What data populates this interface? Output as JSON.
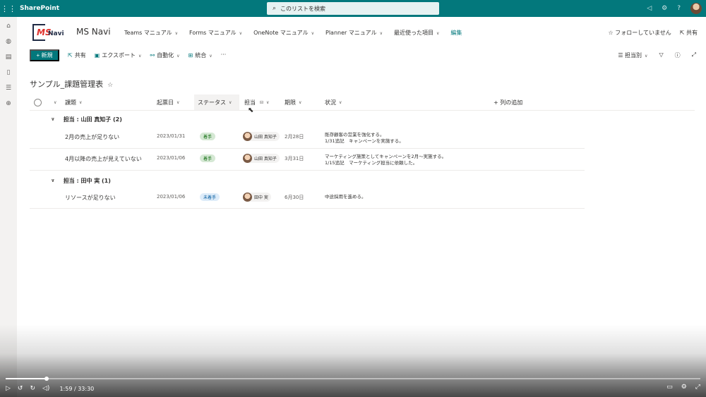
{
  "suitebar": {
    "brand": "SharePoint",
    "search_placeholder": "このリストを検索"
  },
  "site": {
    "logo_ms": "MS",
    "logo_navi": "Navi",
    "title": "MS Navi",
    "nav": [
      {
        "label": "Teams マニュアル"
      },
      {
        "label": "Forms マニュアル"
      },
      {
        "label": "OneNote マニュアル"
      },
      {
        "label": "Planner マニュアル"
      },
      {
        "label": "最近使った項目"
      },
      {
        "label": "編集"
      }
    ],
    "follow": "☆ フォローしていません",
    "share": "共有"
  },
  "commands": {
    "new": "+ 新規",
    "share": "共有",
    "export": "エクスポート",
    "automate": "自動化",
    "integrate": "統合",
    "more": "···",
    "view": "担当別"
  },
  "list": {
    "title": "サンプル_課題管理表",
    "columns": {
      "issue": "課題",
      "date": "起票日",
      "status": "ステータス",
      "assignee": "担当",
      "deadline": "期限",
      "situation": "状況",
      "add": "+ 列の追加"
    },
    "groups": [
      {
        "header": "担当 : 山田 真知子 (2)",
        "rows": [
          {
            "issue": "2月の売上が足りない",
            "date": "2023/01/31",
            "status": "着手",
            "assignee": "山田 真知子",
            "deadline": "2月28日",
            "situation_1": "既存顧客の営業を強化する。",
            "situation_2": "1/31追記　キャンペーンを実施する。"
          },
          {
            "issue": "4月以降の売上が見えていない",
            "date": "2023/01/06",
            "status": "着手",
            "assignee": "山田 真知子",
            "deadline": "3月31日",
            "situation_1": "マーケティング施策としてキャンペーンを2月～実施する。",
            "situation_2": "1/15追記　マーケティング担当に依頼した。"
          }
        ]
      },
      {
        "header": "担当 : 田中 実 (1)",
        "rows": [
          {
            "issue": "リソースが足りない",
            "date": "2023/01/06",
            "status": "未着手",
            "assignee": "田中 実",
            "deadline": "6月30日",
            "situation_1": "中途採用を進める。",
            "situation_2": ""
          }
        ]
      }
    ]
  },
  "video": {
    "time": "1:59 / 33:30",
    "progress": 0.059
  }
}
